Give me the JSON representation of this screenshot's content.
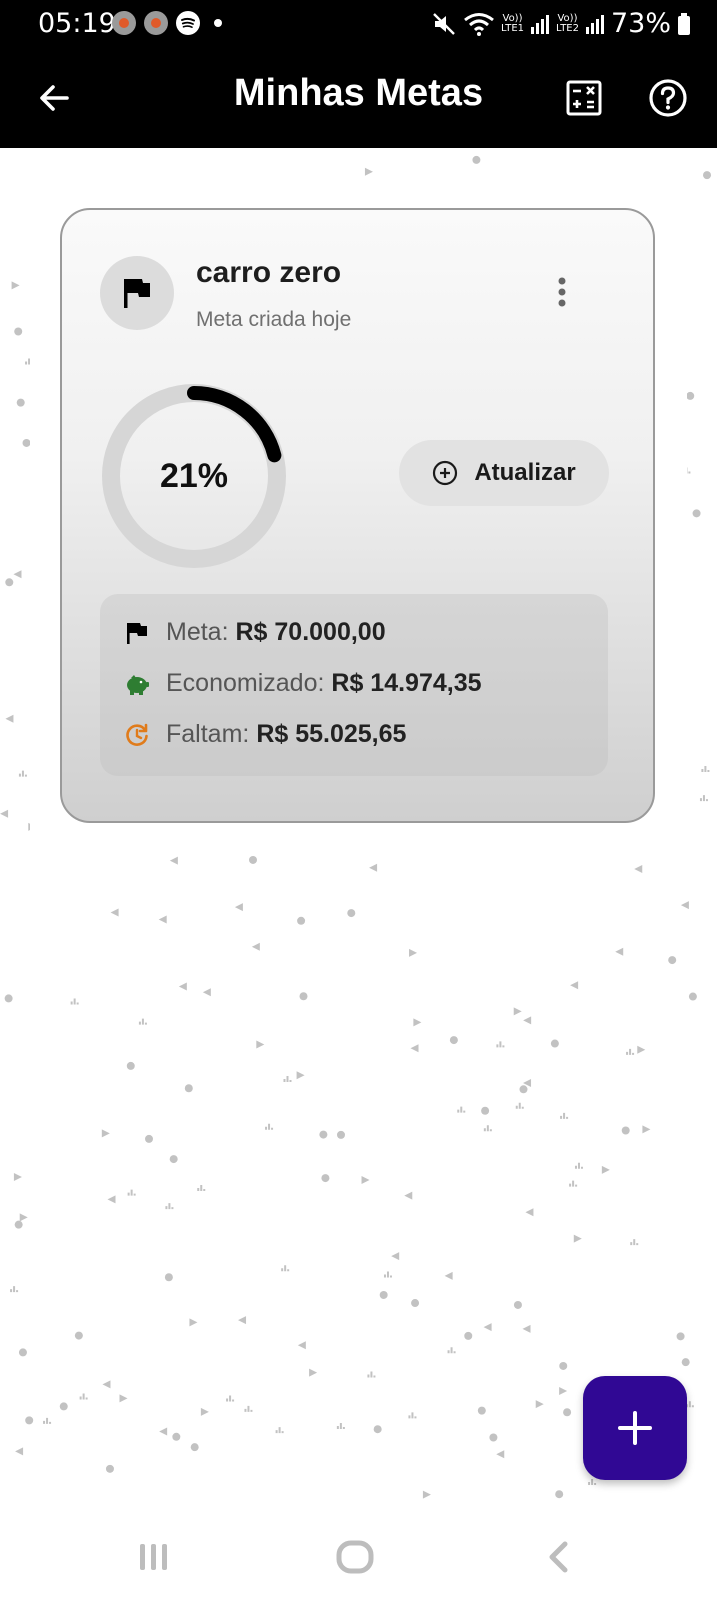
{
  "status_bar": {
    "time": "05:19",
    "battery": "73%",
    "sim1": "LTE1",
    "sim2": "LTE2",
    "volte": "Vo))"
  },
  "app_bar": {
    "title": "Minhas Metas",
    "icons": [
      "back-arrow-icon",
      "calculator-icon",
      "help-icon"
    ]
  },
  "goal": {
    "name": "carro zero",
    "created": "Meta criada hoje",
    "progress_percent": 21,
    "progress_label": "21%",
    "update_label": "Atualizar",
    "target_label": "Meta:",
    "target_value": "R$ 70.000,00",
    "saved_label": "Economizado:",
    "saved_value": "R$ 14.974,35",
    "remaining_label": "Faltam:",
    "remaining_value": "R$ 55.025,65"
  },
  "colors": {
    "fab": "#300894",
    "saved_icon": "#2e7d32",
    "remaining_icon": "#e07b1a",
    "progress_arc": "#000000",
    "progress_track": "#d6d6d6"
  },
  "fab": {
    "icon": "plus-icon"
  },
  "nav_bar": {
    "items": [
      "recent-apps-icon",
      "home-icon",
      "back-icon"
    ]
  }
}
